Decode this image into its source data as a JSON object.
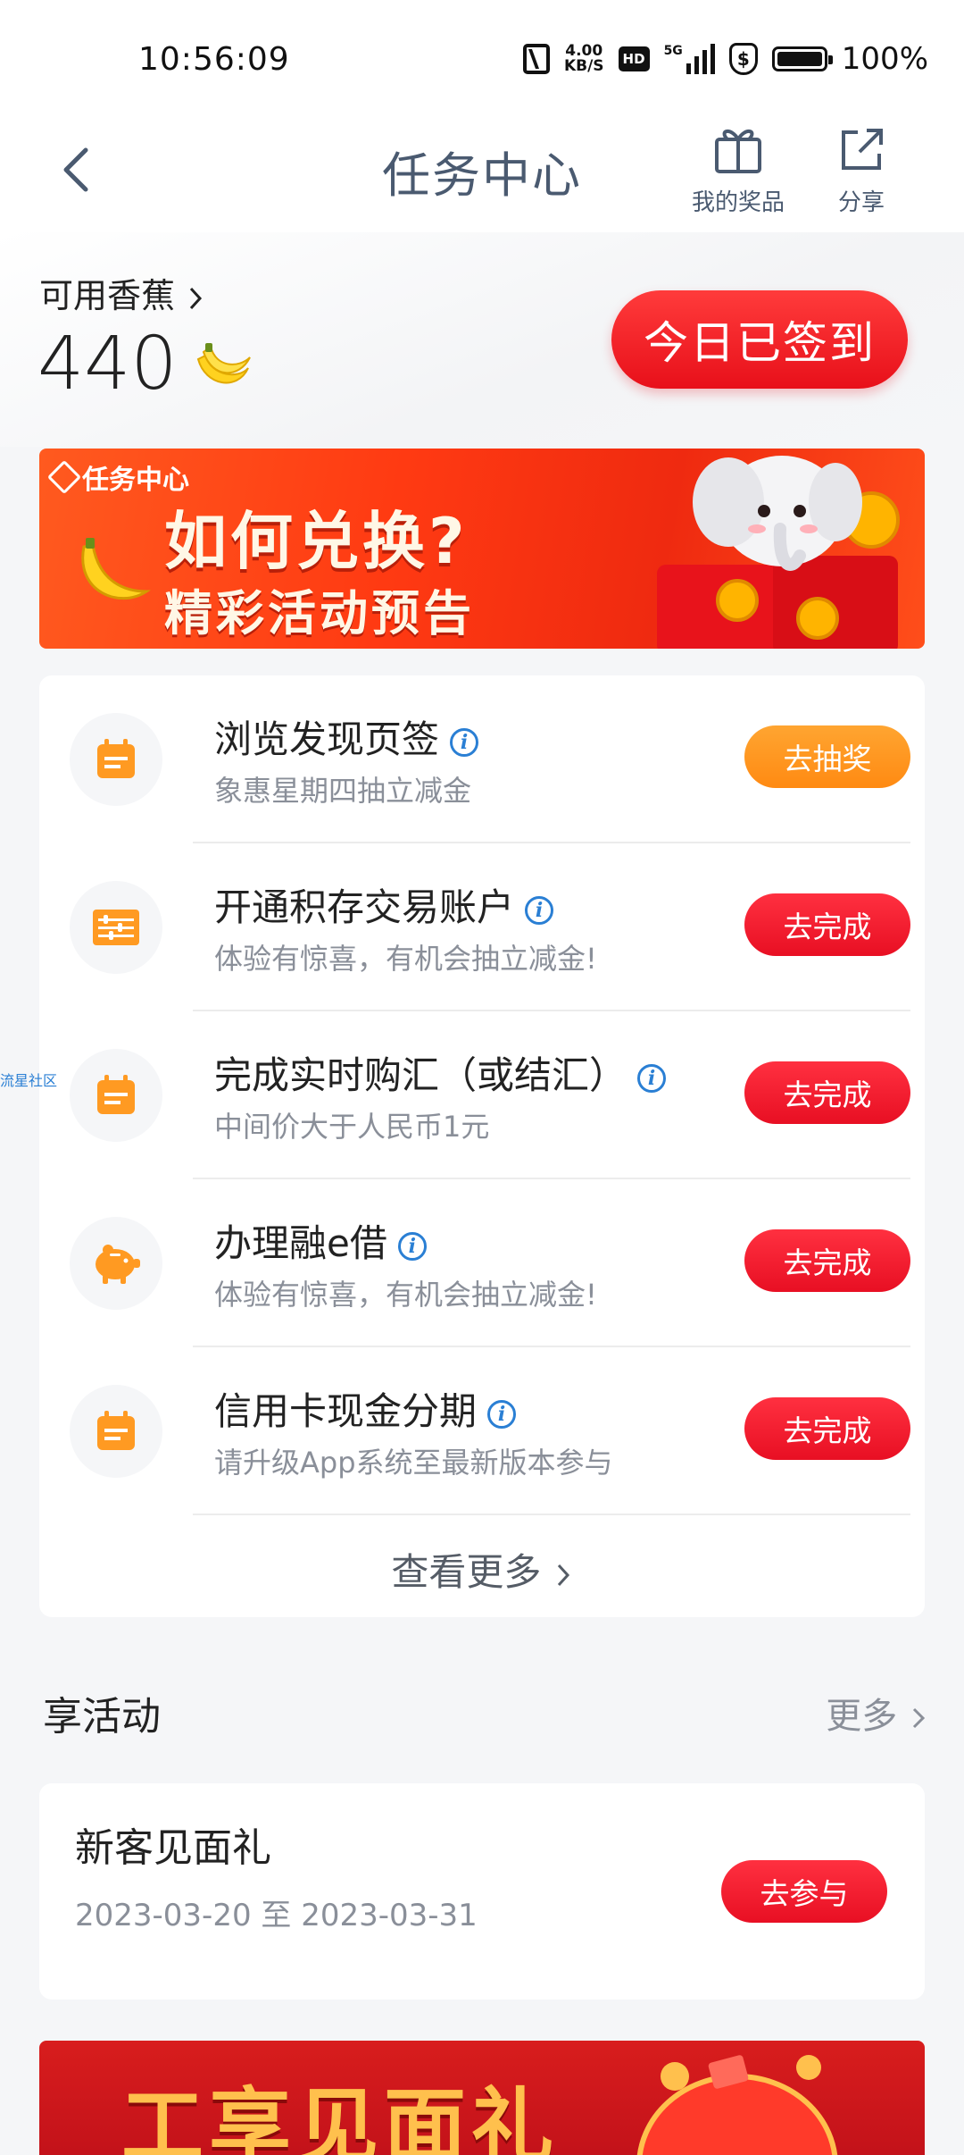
{
  "status_bar": {
    "time": "10:56:09",
    "net_speed_value": "4.00",
    "net_speed_unit": "KB/S",
    "hd_label": "HD",
    "network_label": "5G",
    "battery_text": "100%",
    "battery_level": 1.0
  },
  "header": {
    "title": "任务中心",
    "gift_label": "我的奖品",
    "share_label": "分享"
  },
  "balance": {
    "label": "可用香蕉",
    "value": "440",
    "checkin_label": "今日已签到"
  },
  "banner": {
    "tag": "任务中心",
    "title": "如何兑换?",
    "subtitle": "精彩活动预告"
  },
  "tasks": [
    {
      "icon": "calendar-icon",
      "title": "浏览发现页签",
      "sub": "象惠星期四抽立减金",
      "button": "去抽奖",
      "button_color": "#ff9a22"
    },
    {
      "icon": "abacus-icon",
      "title": "开通积存交易账户",
      "sub": "体验有惊喜，有机会抽立减金!",
      "button": "去完成",
      "button_color": "#ee1c2c"
    },
    {
      "icon": "calendar-icon",
      "title": "完成实时购汇（或结汇）",
      "sub": "中间价大于人民币1元",
      "button": "去完成",
      "button_color": "#ee1c2c"
    },
    {
      "icon": "piggy-bank-icon",
      "title": "办理融e借",
      "sub": "体验有惊喜，有机会抽立减金!",
      "button": "去完成",
      "button_color": "#ee1c2c"
    },
    {
      "icon": "calendar-icon",
      "title": "信用卡现金分期",
      "sub": "请升级App系统至最新版本参与",
      "button": "去完成",
      "button_color": "#ee1c2c"
    }
  ],
  "see_more": "查看更多",
  "activities": {
    "section_title": "享活动",
    "more_label": "更多",
    "items": [
      {
        "title": "新客见面礼",
        "date": "2023-03-20 至 2023-03-31",
        "button": "去参与"
      }
    ]
  },
  "promo": {
    "title": "工享见面礼"
  },
  "side_label": "流星社区",
  "colors": {
    "accent_red": "#ee1c2c",
    "accent_orange": "#ff9a22",
    "icon_orange": "#ff9a22",
    "info_blue": "#2a7fd4"
  }
}
